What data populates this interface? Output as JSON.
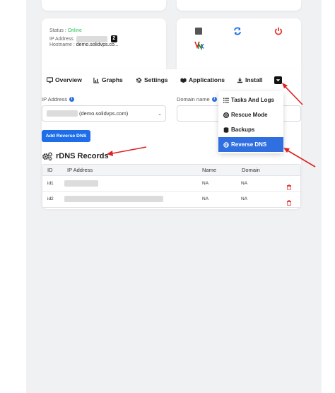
{
  "server_info": {
    "status_label": "Status :",
    "status_value": "Online",
    "ip_label": "IP Address",
    "ip_count": "2",
    "hostname_label": "Hostname :",
    "hostname_value": "demo.solidvps.co..."
  },
  "actions": [
    {
      "icon": "stop-icon"
    },
    {
      "icon": "refresh-icon"
    },
    {
      "icon": "power-icon"
    },
    {
      "icon": "vnc-icon"
    }
  ],
  "tabs": [
    {
      "label": "Overview",
      "icon": "monitor-icon"
    },
    {
      "label": "Graphs",
      "icon": "chart-icon"
    },
    {
      "label": "Settings",
      "icon": "gear-icon"
    },
    {
      "label": "Applications",
      "icon": "boxes-icon"
    },
    {
      "label": "Install",
      "icon": "download-icon"
    }
  ],
  "dropdown": {
    "items": [
      {
        "label": "Tasks And Logs",
        "icon": "list-icon"
      },
      {
        "label": "Rescue Mode",
        "icon": "lifebuoy-icon"
      },
      {
        "label": "Backups",
        "icon": "database-icon"
      },
      {
        "label": "Reverse DNS",
        "icon": "globe-icon",
        "active": true
      }
    ]
  },
  "form": {
    "ip_label": "IP Address",
    "ip_selected": "(demo.solidvps.com)",
    "domain_label": "Domain name",
    "submit_label": "Add Reverse DNS"
  },
  "records": {
    "title": "rDNS Records",
    "columns": [
      "ID",
      "IP Address",
      "Name",
      "Domain"
    ],
    "rows": [
      {
        "id": "id1",
        "name": "NA",
        "domain": "NA"
      },
      {
        "id": "id2",
        "name": "NA",
        "domain": "NA"
      }
    ]
  },
  "colors": {
    "accent": "#1d6ee8",
    "online": "#2dbe60",
    "danger": "#e53935",
    "annotation": "#e02020"
  }
}
